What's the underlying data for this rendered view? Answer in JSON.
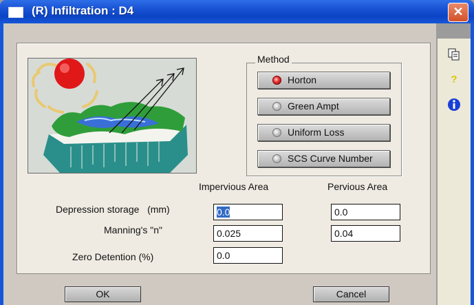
{
  "window": {
    "title": "(R) Infiltration : D4",
    "close_glyph": "✕"
  },
  "method": {
    "legend": "Method",
    "options": [
      {
        "label": "Horton",
        "selected": true
      },
      {
        "label": "Green Ampt",
        "selected": false
      },
      {
        "label": "Uniform Loss",
        "selected": false
      },
      {
        "label": "SCS Curve Number",
        "selected": false
      }
    ]
  },
  "columns": {
    "impervious": "Impervious Area",
    "pervious": "Pervious Area"
  },
  "rows": {
    "depression": {
      "label": "Depression storage   (mm)",
      "impervious": "0.0",
      "pervious": "0.0"
    },
    "manning": {
      "label": "Manning's \"n\"",
      "impervious": "0.025",
      "pervious": "0.04"
    },
    "zero_detention": {
      "label": "Zero Detention (%)",
      "impervious": "0.0"
    }
  },
  "buttons": {
    "ok": "OK",
    "cancel": "Cancel"
  },
  "side_icons": [
    "copy-icon",
    "help-icon",
    "info-icon"
  ],
  "colors": {
    "titlebar": "#0b44c4",
    "selection": "#316ac5",
    "led_on": "#ef3535"
  }
}
